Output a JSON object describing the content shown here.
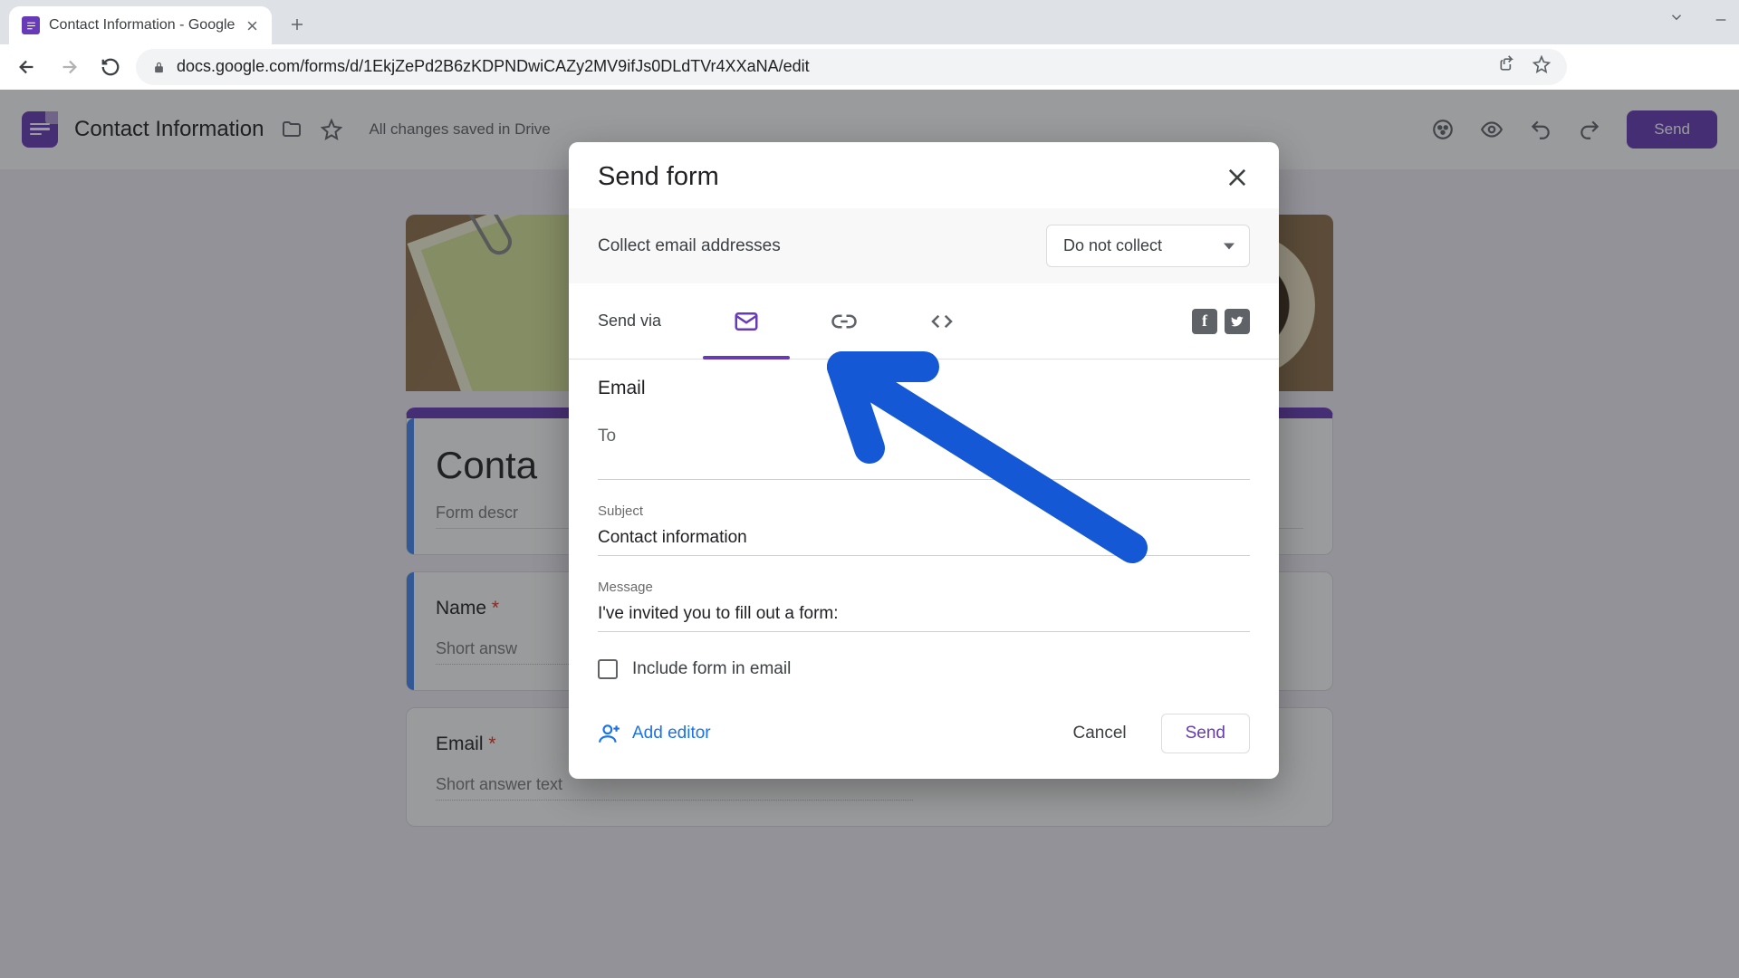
{
  "browser": {
    "tab_title": "Contact Information - Google Fo",
    "url": "docs.google.com/forms/d/1EkjZePd2B6zKDPNDwiCAZy2MV9ifJs0DLdTVr4XXaNA/edit"
  },
  "header": {
    "doc_title": "Contact Information",
    "save_status": "All changes saved in Drive",
    "send_button": "Send"
  },
  "form": {
    "title_fragment": "Conta",
    "description_fragment": "Form descr",
    "q1_label": "Name",
    "q1_answer_fragment": "Short answ",
    "q2_label": "Email",
    "q2_answer": "Short answer text",
    "required_mark": "*"
  },
  "modal": {
    "title": "Send form",
    "collect_label": "Collect email addresses",
    "collect_value": "Do not collect",
    "send_via_label": "Send via",
    "section_heading": "Email",
    "to_label": "To",
    "to_value": "",
    "subject_label": "Subject",
    "subject_value": "Contact information",
    "message_label": "Message",
    "message_value": "I've invited you to fill out a form:",
    "include_label": "Include form in email",
    "add_editor": "Add editor",
    "cancel": "Cancel",
    "send": "Send"
  }
}
